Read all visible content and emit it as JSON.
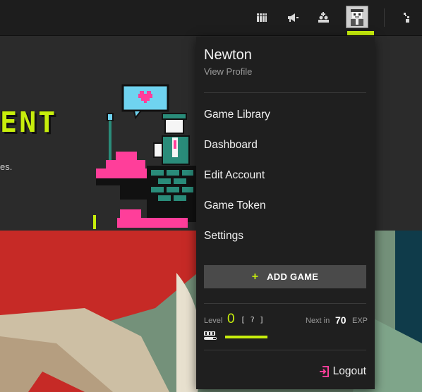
{
  "user": {
    "name": "Newton",
    "view_profile": "View Profile"
  },
  "hero": {
    "title_visible": "ENT",
    "subtitle_fragment": "es."
  },
  "menu": {
    "items": [
      "Game Library",
      "Dashboard",
      "Edit Account",
      "Game Token",
      "Settings"
    ],
    "add_game": "ADD GAME",
    "logout": "Logout"
  },
  "progress": {
    "level_label": "Level",
    "level_value": "0",
    "help": "[ ? ]",
    "next_in_label": "Next in",
    "next_in_value": "70",
    "next_in_unit": "EXP",
    "exp_fraction": 0.3
  },
  "icons": {
    "topbar": [
      "library-icon",
      "announcements-icon",
      "friends-icon",
      "user-avatar-icon",
      "activity-icon"
    ],
    "accent": "#c7ee0c",
    "logout_accent": "#ff3e9a"
  }
}
